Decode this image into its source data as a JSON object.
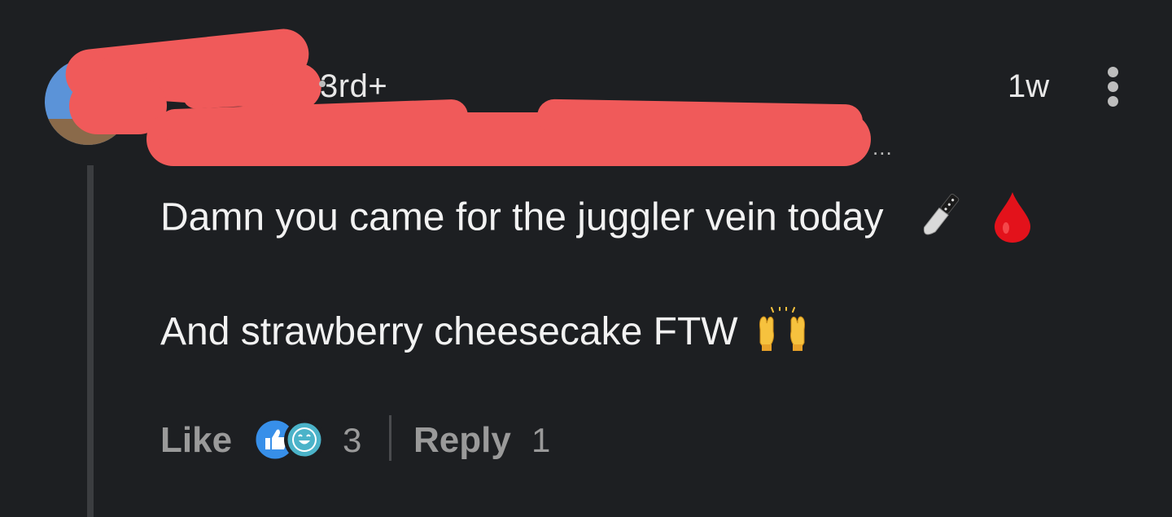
{
  "comment": {
    "author_name": "",
    "connection_degree": "3rd+",
    "headline_ellipsis": "...",
    "timestamp": "1w",
    "line1": "Damn you came for the juggler vein today",
    "line1_emojis": [
      "knife-icon",
      "drop-of-blood-icon"
    ],
    "line2": "And strawberry cheesecake FTW",
    "line2_emojis": [
      "raising-hands-icon"
    ]
  },
  "actions": {
    "like_label": "Like",
    "reaction_icons": [
      "thumbs-up-icon",
      "smiling-face-icon"
    ],
    "reaction_count": "3",
    "reply_label": "Reply",
    "reply_count": "1"
  },
  "colors": {
    "background": "#1d1f22",
    "text_primary": "#f2f2f2",
    "text_secondary": "#9a9a9a",
    "like_blue": "#378fe9",
    "redaction": "#f05a5a"
  }
}
